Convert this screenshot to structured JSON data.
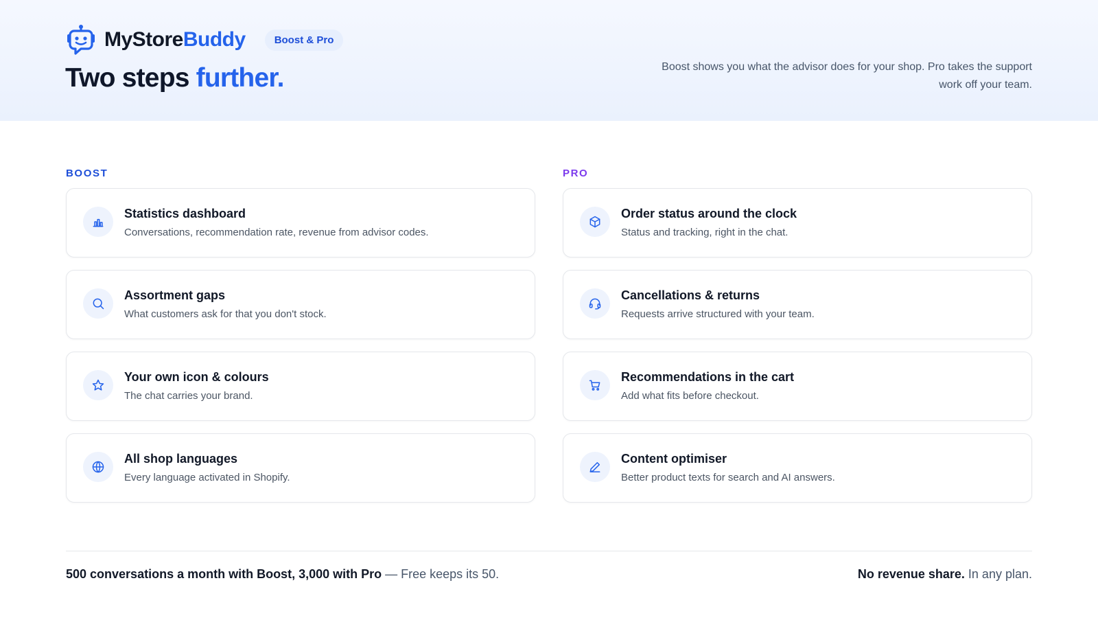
{
  "brand": {
    "name_part1": "MyStore",
    "name_part2": "Buddy",
    "badge": "Boost & Pro"
  },
  "hero": {
    "title_part1": "Two steps",
    "title_accent": "further.",
    "subtitle": "Boost shows you what the advisor does for your shop. Pro takes the support work off your team."
  },
  "boost": {
    "label": "BOOST",
    "items": [
      {
        "title": "Statistics dashboard",
        "desc": "Conversations, recommendation rate, revenue from advisor codes.",
        "icon": "bar-chart-icon"
      },
      {
        "title": "Assortment gaps",
        "desc": "What customers ask for that you don't stock.",
        "icon": "search-icon"
      },
      {
        "title": "Your own icon & colours",
        "desc": "The chat carries your brand.",
        "icon": "star-icon"
      },
      {
        "title": "All shop languages",
        "desc": "Every language activated in Shopify.",
        "icon": "globe-icon"
      }
    ]
  },
  "pro": {
    "label": "PRO",
    "items": [
      {
        "title": "Order status around the clock",
        "desc": "Status and tracking, right in the chat.",
        "icon": "package-icon"
      },
      {
        "title": "Cancellations & returns",
        "desc": "Requests arrive structured with your team.",
        "icon": "headset-icon"
      },
      {
        "title": "Recommendations in the cart",
        "desc": "Add what fits before checkout.",
        "icon": "cart-icon"
      },
      {
        "title": "Content optimiser",
        "desc": "Better product texts for search and AI answers.",
        "icon": "pen-icon"
      }
    ]
  },
  "footer": {
    "left_strong": "500 conversations a month with Boost, 3,000 with Pro",
    "left_muted": " — Free keeps its 50.",
    "right_strong": "No revenue share.",
    "right_muted": " In any plan."
  },
  "colors": {
    "accent": "#2563eb",
    "pro_label": "#7c3aed"
  }
}
